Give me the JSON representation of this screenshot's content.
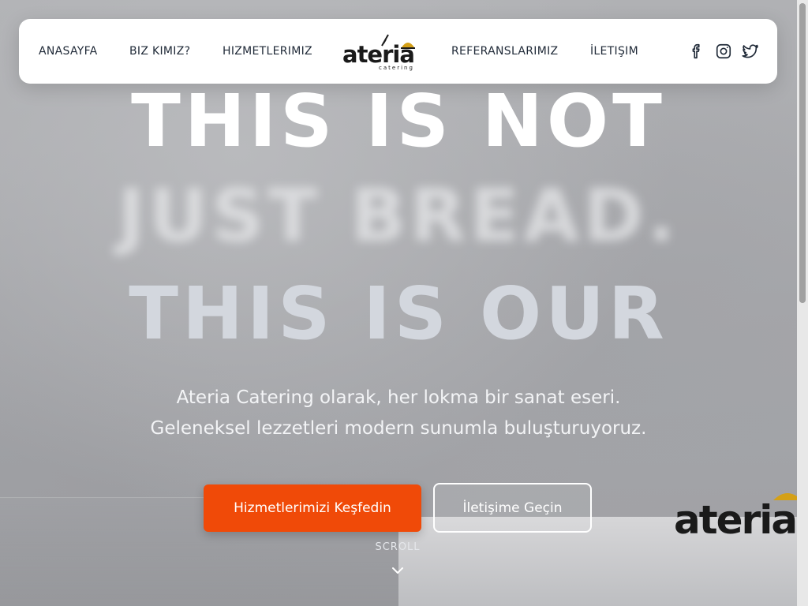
{
  "nav": {
    "left_links": [
      "ANASAYFA",
      "BIZ KIMIZ?",
      "HIZMETLERIMIZ"
    ],
    "right_links": [
      "REFERANSLARIMIZ",
      "İLETIŞIM"
    ],
    "logo": {
      "word": "ateria",
      "sub": "catering"
    },
    "social": [
      "facebook-icon",
      "instagram-icon",
      "twitter-icon"
    ]
  },
  "hero": {
    "line1": "THIS IS NOT",
    "line2": "JUST BREAD.",
    "line3": "THIS IS OUR",
    "subtext_line1": "Ateria Catering olarak, her lokma bir sanat eseri.",
    "subtext_line2": "Geleneksel lezzetleri modern sunumla buluşturuyoruz.",
    "primary_button": "Hizmetlerimizi Keşfedin",
    "secondary_button": "İletişime Geçin",
    "scroll_label": "SCROLL"
  },
  "side_logo": {
    "word": "ateria"
  },
  "colors": {
    "accent": "#f04a08",
    "logo_gold": "#d4a017",
    "logo_red": "#d62d20",
    "logo_dark": "#1a1a1a",
    "nav_text": "#1f2937"
  }
}
